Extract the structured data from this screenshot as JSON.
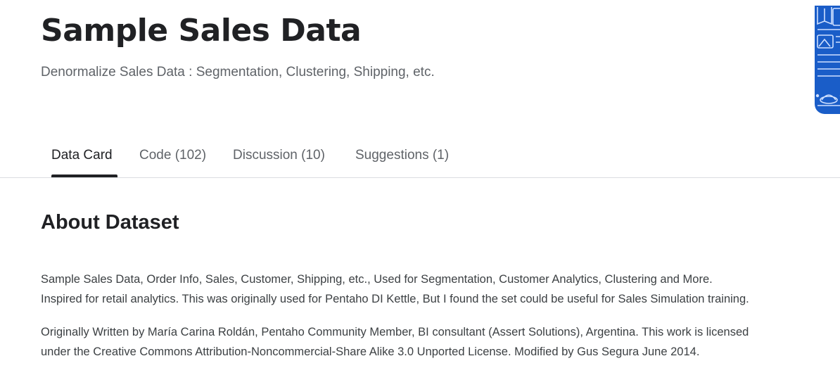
{
  "header": {
    "title": "Sample Sales Data",
    "subtitle": "Denormalize Sales Data : Segmentation, Clustering, Shipping, etc."
  },
  "thumbnail": {
    "icon": "dataset-cover-image",
    "color": "#1a5dc8"
  },
  "tabs": [
    {
      "label": "Data Card",
      "active": true
    },
    {
      "label": "Code (102)",
      "active": false
    },
    {
      "label": "Discussion (10)",
      "active": false
    },
    {
      "label": "Suggestions (1)",
      "active": false
    }
  ],
  "about": {
    "heading": "About Dataset",
    "paragraph1": [
      "Sample Sales Data, Order Info, Sales, Customer, Shipping, etc., Used for Segmentation, Customer Analytics, Clustering and More.",
      "Inspired for retail analytics. This was originally used for Pentaho DI Kettle, But I found the set could be useful for Sales Simulation training."
    ],
    "paragraph2": [
      "Originally Written by María Carina Roldán, Pentaho Community Member, BI consultant (Assert Solutions), Argentina. This work is licensed",
      "under the Creative Commons Attribution-Noncommercial-Share Alike 3.0 Unported License. Modified by Gus Segura June 2014."
    ]
  }
}
